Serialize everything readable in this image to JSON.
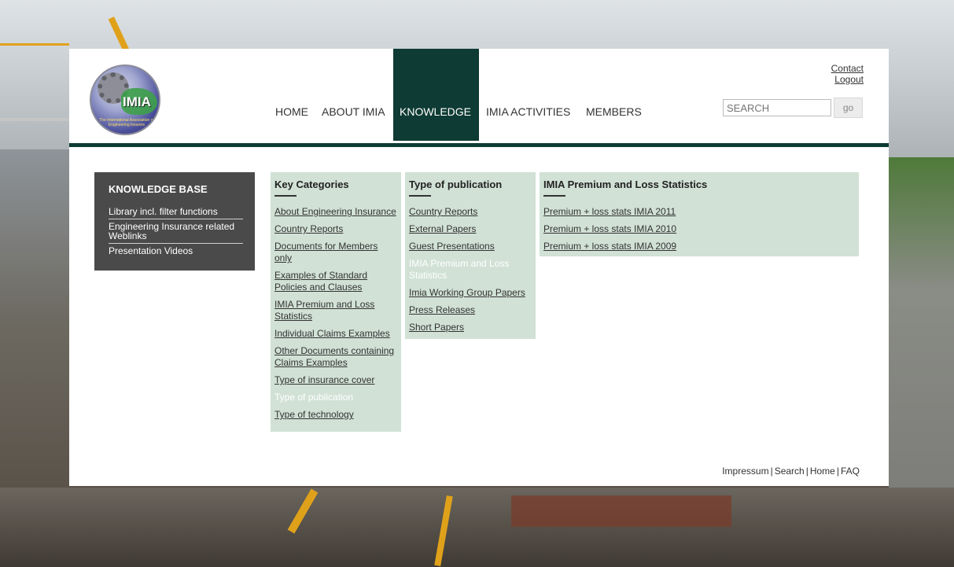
{
  "logo": {
    "word": "IMIA",
    "tagline": "The International Association of Engineering Insurers"
  },
  "nav": [
    {
      "label": "HOME"
    },
    {
      "label": "ABOUT IMIA"
    },
    {
      "label": "KNOWLEDGE"
    },
    {
      "label": "IMIA ACTIVITIES"
    },
    {
      "label": "MEMBERS"
    }
  ],
  "topright": {
    "contact": "Contact",
    "logout": "Logout"
  },
  "search": {
    "placeholder": "SEARCH",
    "go_label": "go"
  },
  "knowledge_base": {
    "title": "KNOWLEDGE BASE",
    "items": [
      {
        "label": "Library incl. filter functions"
      },
      {
        "label": "Engineering Insurance related Weblinks"
      },
      {
        "label": "Presentation Videos"
      }
    ]
  },
  "key_categories": {
    "title": "Key Categories",
    "items": [
      {
        "label": "About Engineering Insurance"
      },
      {
        "label": "Country Reports"
      },
      {
        "label": "Documents for Members only"
      },
      {
        "label": "Examples of Standard Policies and Clauses"
      },
      {
        "label": "IMIA Premium and Loss Statistics"
      },
      {
        "label": "Individual Claims Examples"
      },
      {
        "label": "Other Documents containing Claims Examples"
      },
      {
        "label": "Type of insurance cover"
      },
      {
        "label": "Type of publication",
        "current": true
      },
      {
        "label": "Type of technology"
      }
    ]
  },
  "type_of_publication": {
    "title": "Type of publication",
    "items": [
      {
        "label": "Country Reports"
      },
      {
        "label": "External Papers"
      },
      {
        "label": "Guest Presentations"
      },
      {
        "label": "IMIA Premium and Loss Statistics",
        "current": true
      },
      {
        "label": "Imia Working Group Papers"
      },
      {
        "label": "Press Releases"
      },
      {
        "label": "Short Papers"
      }
    ]
  },
  "premium_stats": {
    "title": "IMIA Premium and Loss Statistics",
    "items": [
      {
        "label": "Premium + loss stats IMIA 2011"
      },
      {
        "label": "Premium + loss stats IMIA 2010"
      },
      {
        "label": "Premium + loss stats IMIA 2009"
      }
    ]
  },
  "footer": {
    "impressum": "Impressum",
    "sep": "|",
    "search": "Search",
    "home": "Home",
    "faq": "FAQ"
  },
  "colors": {
    "accent": "#0e3b33",
    "panel": "#d1e1d6",
    "kb_bg": "#4a4a4a"
  }
}
